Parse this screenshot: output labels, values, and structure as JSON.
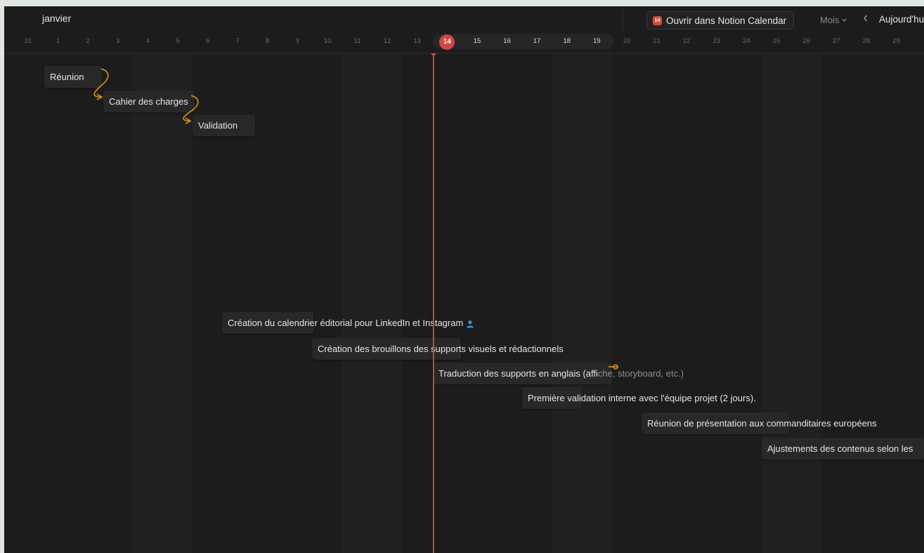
{
  "header": {
    "month": "janvier",
    "open_notion_label": "Ouvrir dans Notion Calendar",
    "notion_icon_day": "14",
    "mode_label": "Mois",
    "today_label": "Aujourd'hui"
  },
  "days": [
    "31",
    "1",
    "2",
    "3",
    "4",
    "5",
    "6",
    "7",
    "8",
    "9",
    "10",
    "11",
    "12",
    "13",
    "14",
    "15",
    "16",
    "17",
    "18",
    "19",
    "20",
    "21",
    "22",
    "23",
    "24",
    "25",
    "26",
    "27",
    "28",
    "29"
  ],
  "today": "14",
  "tasks": [
    {
      "label": "Réunion"
    },
    {
      "label": "Cahier des charges"
    },
    {
      "label": "Validation"
    },
    {
      "label": "Création du calendrier éditorial pour LinkedIn et Instagram"
    },
    {
      "label": "Création des brouillons des supports visuels et rédactionnels"
    },
    {
      "label_main": "Traduction des supports en anglais (affi",
      "label_faded": "che, storyboard, etc.)"
    },
    {
      "label": "Première validation interne avec l'équipe projet (2 jours)."
    },
    {
      "label": "Réunion de présentation aux commanditaires européens"
    },
    {
      "label": "Ajustements des contenus selon les"
    }
  ],
  "colors": {
    "accent_today": "#d2463f",
    "dependency": "#c98a1c",
    "background": "#1c1c1c",
    "person_icon": "#3d8fd9"
  },
  "icons": [
    "calendar-icon",
    "chevron-down-icon",
    "chevron-left-icon",
    "person-icon",
    "dependency-arrow-icon"
  ]
}
